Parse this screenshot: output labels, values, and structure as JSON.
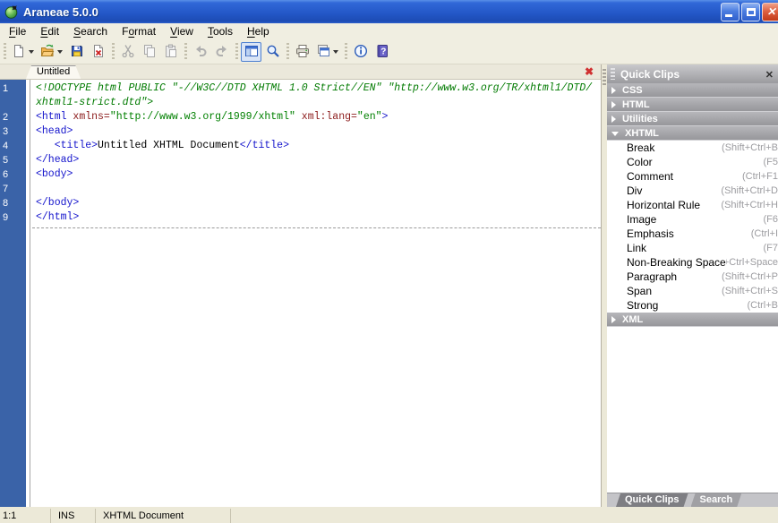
{
  "window": {
    "title": "Araneae 5.0.0"
  },
  "titlebar": {
    "buttons": [
      "minimize",
      "maximize",
      "close"
    ]
  },
  "menubar": {
    "items": [
      {
        "label": "File",
        "pre": "",
        "key": "F",
        "post": "ile"
      },
      {
        "label": "Edit",
        "pre": "",
        "key": "E",
        "post": "dit"
      },
      {
        "label": "Search",
        "pre": "",
        "key": "S",
        "post": "earch"
      },
      {
        "label": "Format",
        "pre": "F",
        "key": "o",
        "post": "rmat"
      },
      {
        "label": "View",
        "pre": "",
        "key": "V",
        "post": "iew"
      },
      {
        "label": "Tools",
        "pre": "",
        "key": "T",
        "post": "ools"
      },
      {
        "label": "Help",
        "pre": "",
        "key": "H",
        "post": "elp"
      }
    ]
  },
  "toolbar": {
    "groups": [
      {
        "buttons": [
          {
            "name": "new-button",
            "icon": "new-page-icon",
            "caret": true
          },
          {
            "name": "open-button",
            "icon": "open-folder-icon",
            "caret": true
          },
          {
            "name": "save-button",
            "icon": "save-icon"
          },
          {
            "name": "close-document-button",
            "icon": "close-document-icon"
          }
        ]
      },
      {
        "buttons": [
          {
            "name": "cut-button",
            "icon": "cut-icon",
            "disabled": true
          },
          {
            "name": "copy-button",
            "icon": "copy-icon",
            "disabled": true
          },
          {
            "name": "paste-button",
            "icon": "paste-icon",
            "disabled": true
          }
        ]
      },
      {
        "buttons": [
          {
            "name": "undo-button",
            "icon": "undo-icon",
            "disabled": true
          },
          {
            "name": "redo-button",
            "icon": "redo-icon",
            "disabled": true
          }
        ]
      },
      {
        "buttons": [
          {
            "name": "toggle-panel-button",
            "icon": "toggle-panel-icon",
            "pressed": true
          },
          {
            "name": "zoom-button",
            "icon": "magnifier-icon"
          }
        ]
      },
      {
        "buttons": [
          {
            "name": "print-button",
            "icon": "print-icon"
          },
          {
            "name": "browser-preview-button",
            "icon": "browser-preview-icon",
            "caret": true
          }
        ]
      },
      {
        "buttons": [
          {
            "name": "info-button",
            "icon": "info-icon"
          },
          {
            "name": "help-button",
            "icon": "help-icon"
          }
        ]
      }
    ]
  },
  "tabbar": {
    "tabs": [
      {
        "label": "Untitled"
      }
    ]
  },
  "editor": {
    "rows": [
      {
        "n": "1",
        "segs": [
          {
            "c": "doctype",
            "t": "<!DOCTYPE html PUBLIC \"-//W3C//DTD XHTML 1.0 Strict//EN\" \"http://www.w3.org/TR/xhtml1/DTD/"
          }
        ]
      },
      {
        "n": "",
        "segs": [
          {
            "c": "doctype",
            "t": "xhtml1-strict.dtd\">"
          }
        ]
      },
      {
        "n": "2",
        "segs": [
          {
            "c": "tag",
            "t": "<html "
          },
          {
            "c": "attr",
            "t": "xmlns="
          },
          {
            "c": "value",
            "t": "\"http://www.w3.org/1999/xhtml\""
          },
          {
            "c": "plain",
            "t": " "
          },
          {
            "c": "attr",
            "t": "xml:lang="
          },
          {
            "c": "value",
            "t": "\"en\""
          },
          {
            "c": "tag",
            "t": ">"
          }
        ]
      },
      {
        "n": "3",
        "segs": [
          {
            "c": "tag",
            "t": "<head>"
          }
        ]
      },
      {
        "n": "4",
        "segs": [
          {
            "c": "plain",
            "t": "   "
          },
          {
            "c": "tag",
            "t": "<title>"
          },
          {
            "c": "plain",
            "t": "Untitled XHTML Document"
          },
          {
            "c": "tag",
            "t": "</title>"
          }
        ]
      },
      {
        "n": "5",
        "segs": [
          {
            "c": "tag",
            "t": "</head>"
          }
        ]
      },
      {
        "n": "6",
        "segs": [
          {
            "c": "tag",
            "t": "<body>"
          }
        ]
      },
      {
        "n": "7",
        "segs": []
      },
      {
        "n": "8",
        "segs": [
          {
            "c": "tag",
            "t": "</body>"
          }
        ]
      },
      {
        "n": "9",
        "segs": [
          {
            "c": "tag",
            "t": "</html>"
          }
        ]
      }
    ]
  },
  "quick_clips": {
    "title": "Quick Clips",
    "sections": [
      {
        "label": "CSS",
        "state": "collapsed"
      },
      {
        "label": "HTML",
        "state": "collapsed"
      },
      {
        "label": "Utilities",
        "state": "collapsed"
      },
      {
        "label": "XHTML",
        "state": "expanded",
        "items": [
          {
            "label": "Break",
            "shortcut": "(Shift+Ctrl+B"
          },
          {
            "label": "Color",
            "shortcut": "(F5"
          },
          {
            "label": "Comment",
            "shortcut": "(Ctrl+F1"
          },
          {
            "label": "Div",
            "shortcut": "(Shift+Ctrl+D"
          },
          {
            "label": "Horizontal Rule",
            "shortcut": "(Shift+Ctrl+H"
          },
          {
            "label": "Image",
            "shortcut": "(F6"
          },
          {
            "label": "Emphasis",
            "shortcut": "(Ctrl+I"
          },
          {
            "label": "Link",
            "shortcut": "(F7"
          },
          {
            "label": "Non-Breaking Space",
            "shortcut": "(Shift+Ctrl+Space"
          },
          {
            "label": "Paragraph",
            "shortcut": "(Shift+Ctrl+P"
          },
          {
            "label": "Span",
            "shortcut": "(Shift+Ctrl+S"
          },
          {
            "label": "Strong",
            "shortcut": "(Ctrl+B"
          }
        ]
      },
      {
        "label": "XML",
        "state": "collapsed"
      }
    ],
    "bottom_tabs": [
      {
        "label": "Quick Clips",
        "active": true
      },
      {
        "label": "Search",
        "active": false
      }
    ]
  },
  "statusbar": {
    "cells": [
      {
        "name": "cursor-position",
        "text": "1:1"
      },
      {
        "name": "insert-mode",
        "text": "INS"
      },
      {
        "name": "document-type",
        "text": "XHTML Document"
      }
    ]
  },
  "colors": {
    "titlebar_blue": "#2458C8",
    "gutter_blue": "#3A63A8",
    "syntax_tag": "#1414CC",
    "syntax_attr": "#8B1A1A",
    "syntax_value": "#008000",
    "syntax_doctype": "#007A00",
    "panel_header_gray": "#A3A3A7",
    "chrome_bg": "#ECE9D8",
    "tab_close_red": "#D03030"
  }
}
